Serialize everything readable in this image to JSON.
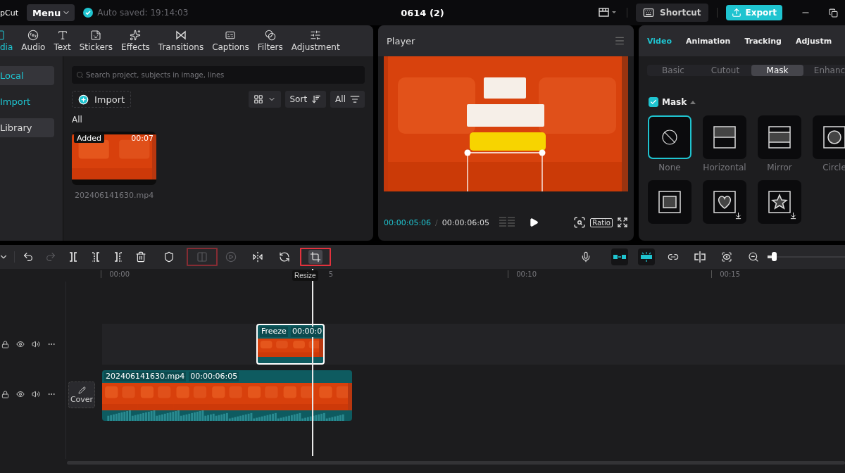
{
  "topbar": {
    "logo": "pCut",
    "menu": "Menu",
    "autosave": "Auto saved: 19:14:03",
    "title": "0614 (2)",
    "shortcut": "Shortcut",
    "export": "Export"
  },
  "media_tabs": [
    {
      "kind": "media",
      "label": "dia",
      "selected": true
    },
    {
      "kind": "audio",
      "label": "Audio",
      "selected": false
    },
    {
      "kind": "text",
      "label": "Text",
      "selected": false
    },
    {
      "kind": "stickers",
      "label": "Stickers",
      "selected": false
    },
    {
      "kind": "effects",
      "label": "Effects",
      "selected": false
    },
    {
      "kind": "transitions",
      "label": "Transitions",
      "selected": false
    },
    {
      "kind": "captions",
      "label": "Captions",
      "selected": false
    },
    {
      "kind": "filters",
      "label": "Filters",
      "selected": false
    },
    {
      "kind": "adjustment",
      "label": "Adjustment",
      "selected": false
    }
  ],
  "media_sidebar": [
    {
      "kind": "source",
      "label": "Local",
      "selected": true,
      "hovered": false
    },
    {
      "kind": "action",
      "label": "Import",
      "selected": false,
      "hovered": false
    },
    {
      "kind": "source",
      "label": "Library",
      "selected": false,
      "hovered": true
    }
  ],
  "search": {
    "placeholder": "Search project, subjects in image, lines"
  },
  "media_toolbar": {
    "import": "Import",
    "sort": "Sort",
    "filter": "All"
  },
  "section_label": "All",
  "media_items": [
    {
      "kind": "picture",
      "badge": "Added",
      "duration": "00:07",
      "name": "202406141630.mp4"
    }
  ],
  "player": {
    "title": "Player",
    "current_time": "00:00:05:06",
    "separator": "/",
    "total_time": "00:00:06:05",
    "ratio": "Ratio"
  },
  "inspector": {
    "tabs": [
      {
        "label": "Video",
        "selected": true
      },
      {
        "label": "Animation",
        "selected": false
      },
      {
        "label": "Tracking",
        "selected": false
      },
      {
        "label": "Adjustm",
        "selected": false
      }
    ],
    "subtabs": [
      {
        "label": "Basic",
        "selected": false
      },
      {
        "label": "Cutout",
        "selected": false
      },
      {
        "label": "Mask",
        "selected": true
      },
      {
        "label": "Enhanc",
        "selected": false
      }
    ],
    "mask_toggle": {
      "label": "Mask",
      "checked": true
    },
    "masks": [
      {
        "kind": "none",
        "label": "None",
        "selected": true,
        "download": false
      },
      {
        "kind": "horizontal",
        "label": "Horizontal",
        "selected": false,
        "download": false
      },
      {
        "kind": "mirror",
        "label": "Mirror",
        "selected": false,
        "download": false
      },
      {
        "kind": "circle",
        "label": "Circle",
        "selected": false
      },
      {
        "kind": "rectangle",
        "selected": false,
        "download": false
      },
      {
        "kind": "heart",
        "selected": false,
        "download": true
      },
      {
        "kind": "star",
        "selected": false,
        "download": true
      }
    ]
  },
  "tools": [
    {
      "kind": "undo",
      "disabled": false,
      "active": false,
      "highlighted": false
    },
    {
      "kind": "redo",
      "disabled": true,
      "active": false,
      "highlighted": false
    },
    {
      "kind": "split",
      "disabled": false,
      "active": false,
      "highlighted": false
    },
    {
      "kind": "split-left",
      "disabled": false,
      "active": false,
      "highlighted": false
    },
    {
      "kind": "split-right",
      "disabled": false,
      "active": false,
      "highlighted": false
    },
    {
      "kind": "delete",
      "disabled": false,
      "active": false,
      "highlighted": false
    },
    {
      "kind": "marker",
      "disabled": false,
      "active": false,
      "highlighted": false
    },
    {
      "kind": "freeze",
      "disabled": true,
      "active": false,
      "highlighted": true
    },
    {
      "kind": "reverse",
      "disabled": true,
      "active": false,
      "highlighted": false
    },
    {
      "kind": "mirror",
      "disabled": false,
      "active": false,
      "highlighted": false
    },
    {
      "kind": "rotate",
      "disabled": false,
      "active": false,
      "highlighted": false
    },
    {
      "kind": "crop",
      "disabled": false,
      "active": true,
      "highlighted": true,
      "tooltip": "Resize"
    }
  ],
  "right_tools": [
    {
      "kind": "mic",
      "active": false
    },
    {
      "kind": "magnet",
      "active": true
    },
    {
      "kind": "snap",
      "active": true
    },
    {
      "kind": "link",
      "active": false
    },
    {
      "kind": "preview-axis",
      "active": false
    },
    {
      "kind": "zoom-fit",
      "active": false
    },
    {
      "kind": "zoom-out",
      "active": false
    }
  ],
  "zoom": {
    "level": 0.05
  },
  "ruler": [
    "00:00",
    "5",
    "00:10",
    "00:15"
  ],
  "tracks": [
    {
      "kind": "overlay",
      "clips": [
        {
          "label": "Freeze",
          "duration": "00:00:0",
          "selected": true
        }
      ]
    },
    {
      "kind": "main",
      "cover": "Cover",
      "clips": [
        {
          "label": "202406141630.mp4",
          "duration": "00:00:06:05",
          "selected": false
        }
      ]
    }
  ]
}
